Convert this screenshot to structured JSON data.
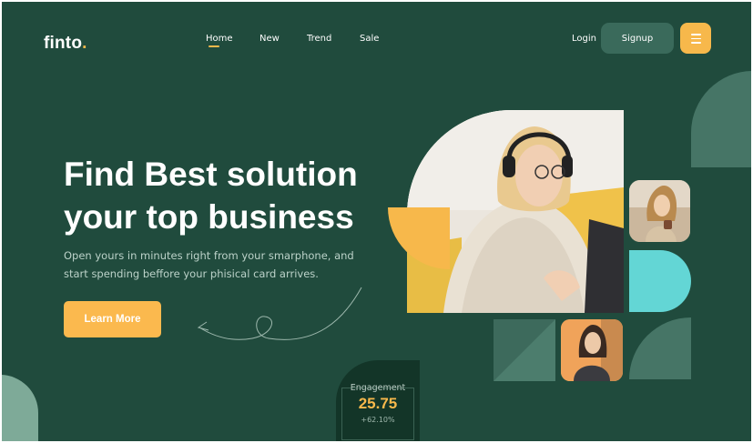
{
  "brand": {
    "name": "finto",
    "dot": ".",
    "accent_color": "#f7b84b",
    "background_color": "#204b3d"
  },
  "nav": {
    "items": [
      {
        "label": "Home",
        "active": true
      },
      {
        "label": "New"
      },
      {
        "label": "Trend"
      },
      {
        "label": "Sale"
      }
    ]
  },
  "auth": {
    "login_label": "Login",
    "signup_label": "Signup",
    "menu_icon": "hamburger-menu-icon"
  },
  "hero": {
    "headline_line1": "Find Best solution",
    "headline_line2": "your top business",
    "subtext": "Open yours in minutes right from your smarphone, and start spending beffore your phisical card arrives.",
    "cta_label": "Learn More"
  },
  "stats": {
    "label": "Engagement",
    "value": "25.75",
    "change": "+62.10%"
  },
  "decor_colors": {
    "cyan": "#63d6d5",
    "teal": "#467566",
    "yellow": "#f7b84b"
  }
}
